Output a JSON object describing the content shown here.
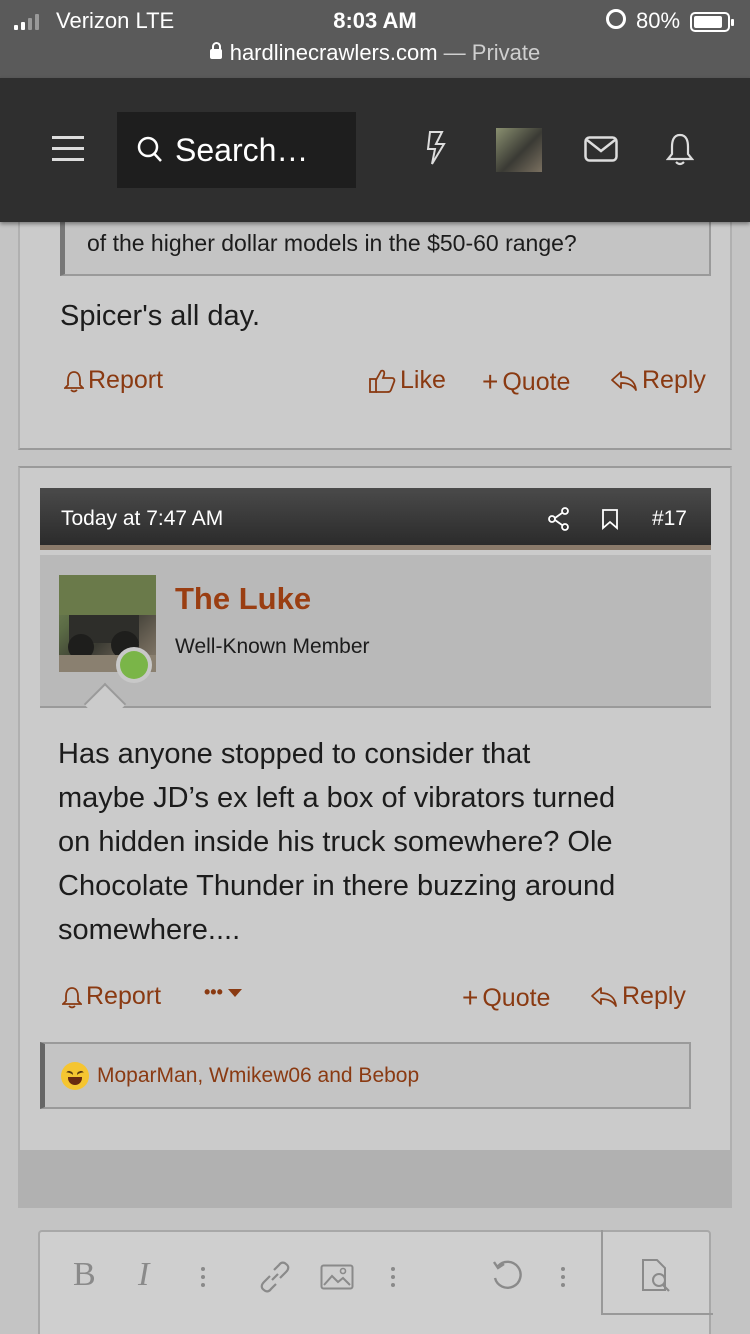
{
  "status_bar": {
    "carrier": "Verizon  LTE",
    "time": "8:03 AM",
    "battery": "80%",
    "battery_level": 0.8
  },
  "browser": {
    "domain": "hardlinecrawlers.com",
    "separator": " — ",
    "mode": "Private"
  },
  "header": {
    "search_placeholder": "Search…",
    "icons": [
      "menu-icon",
      "search-icon",
      "bolt-icon",
      "user-avatar",
      "mail-icon",
      "bell-icon"
    ]
  },
  "post16": {
    "quote_text": "of the higher dollar models in the $50-60 range?",
    "body": "Spicer's all day.",
    "actions": {
      "report": "Report",
      "like": "Like",
      "quote": "Quote",
      "reply": "Reply"
    }
  },
  "post17": {
    "timestamp": "Today at 7:47 AM",
    "number": "#17",
    "author": {
      "name": "The Luke",
      "title": "Well-Known Member"
    },
    "body_lines": [
      "Has anyone stopped to consider that",
      "maybe JD’s ex left a box of vibrators turned",
      "on hidden inside his truck somewhere? Ole",
      "Chocolate Thunder in there buzzing around",
      "somewhere...."
    ],
    "actions": {
      "report": "Report",
      "more": "•••",
      "quote": "Quote",
      "reply": "Reply"
    },
    "reactions": "MoparMan, Wmikew06 and Bebop"
  },
  "editor": {
    "toolbar": [
      "B",
      "I"
    ]
  },
  "colors": {
    "accent": "#9a3e12",
    "header_bg": "#2f2f2f",
    "online": "#7ab548"
  }
}
